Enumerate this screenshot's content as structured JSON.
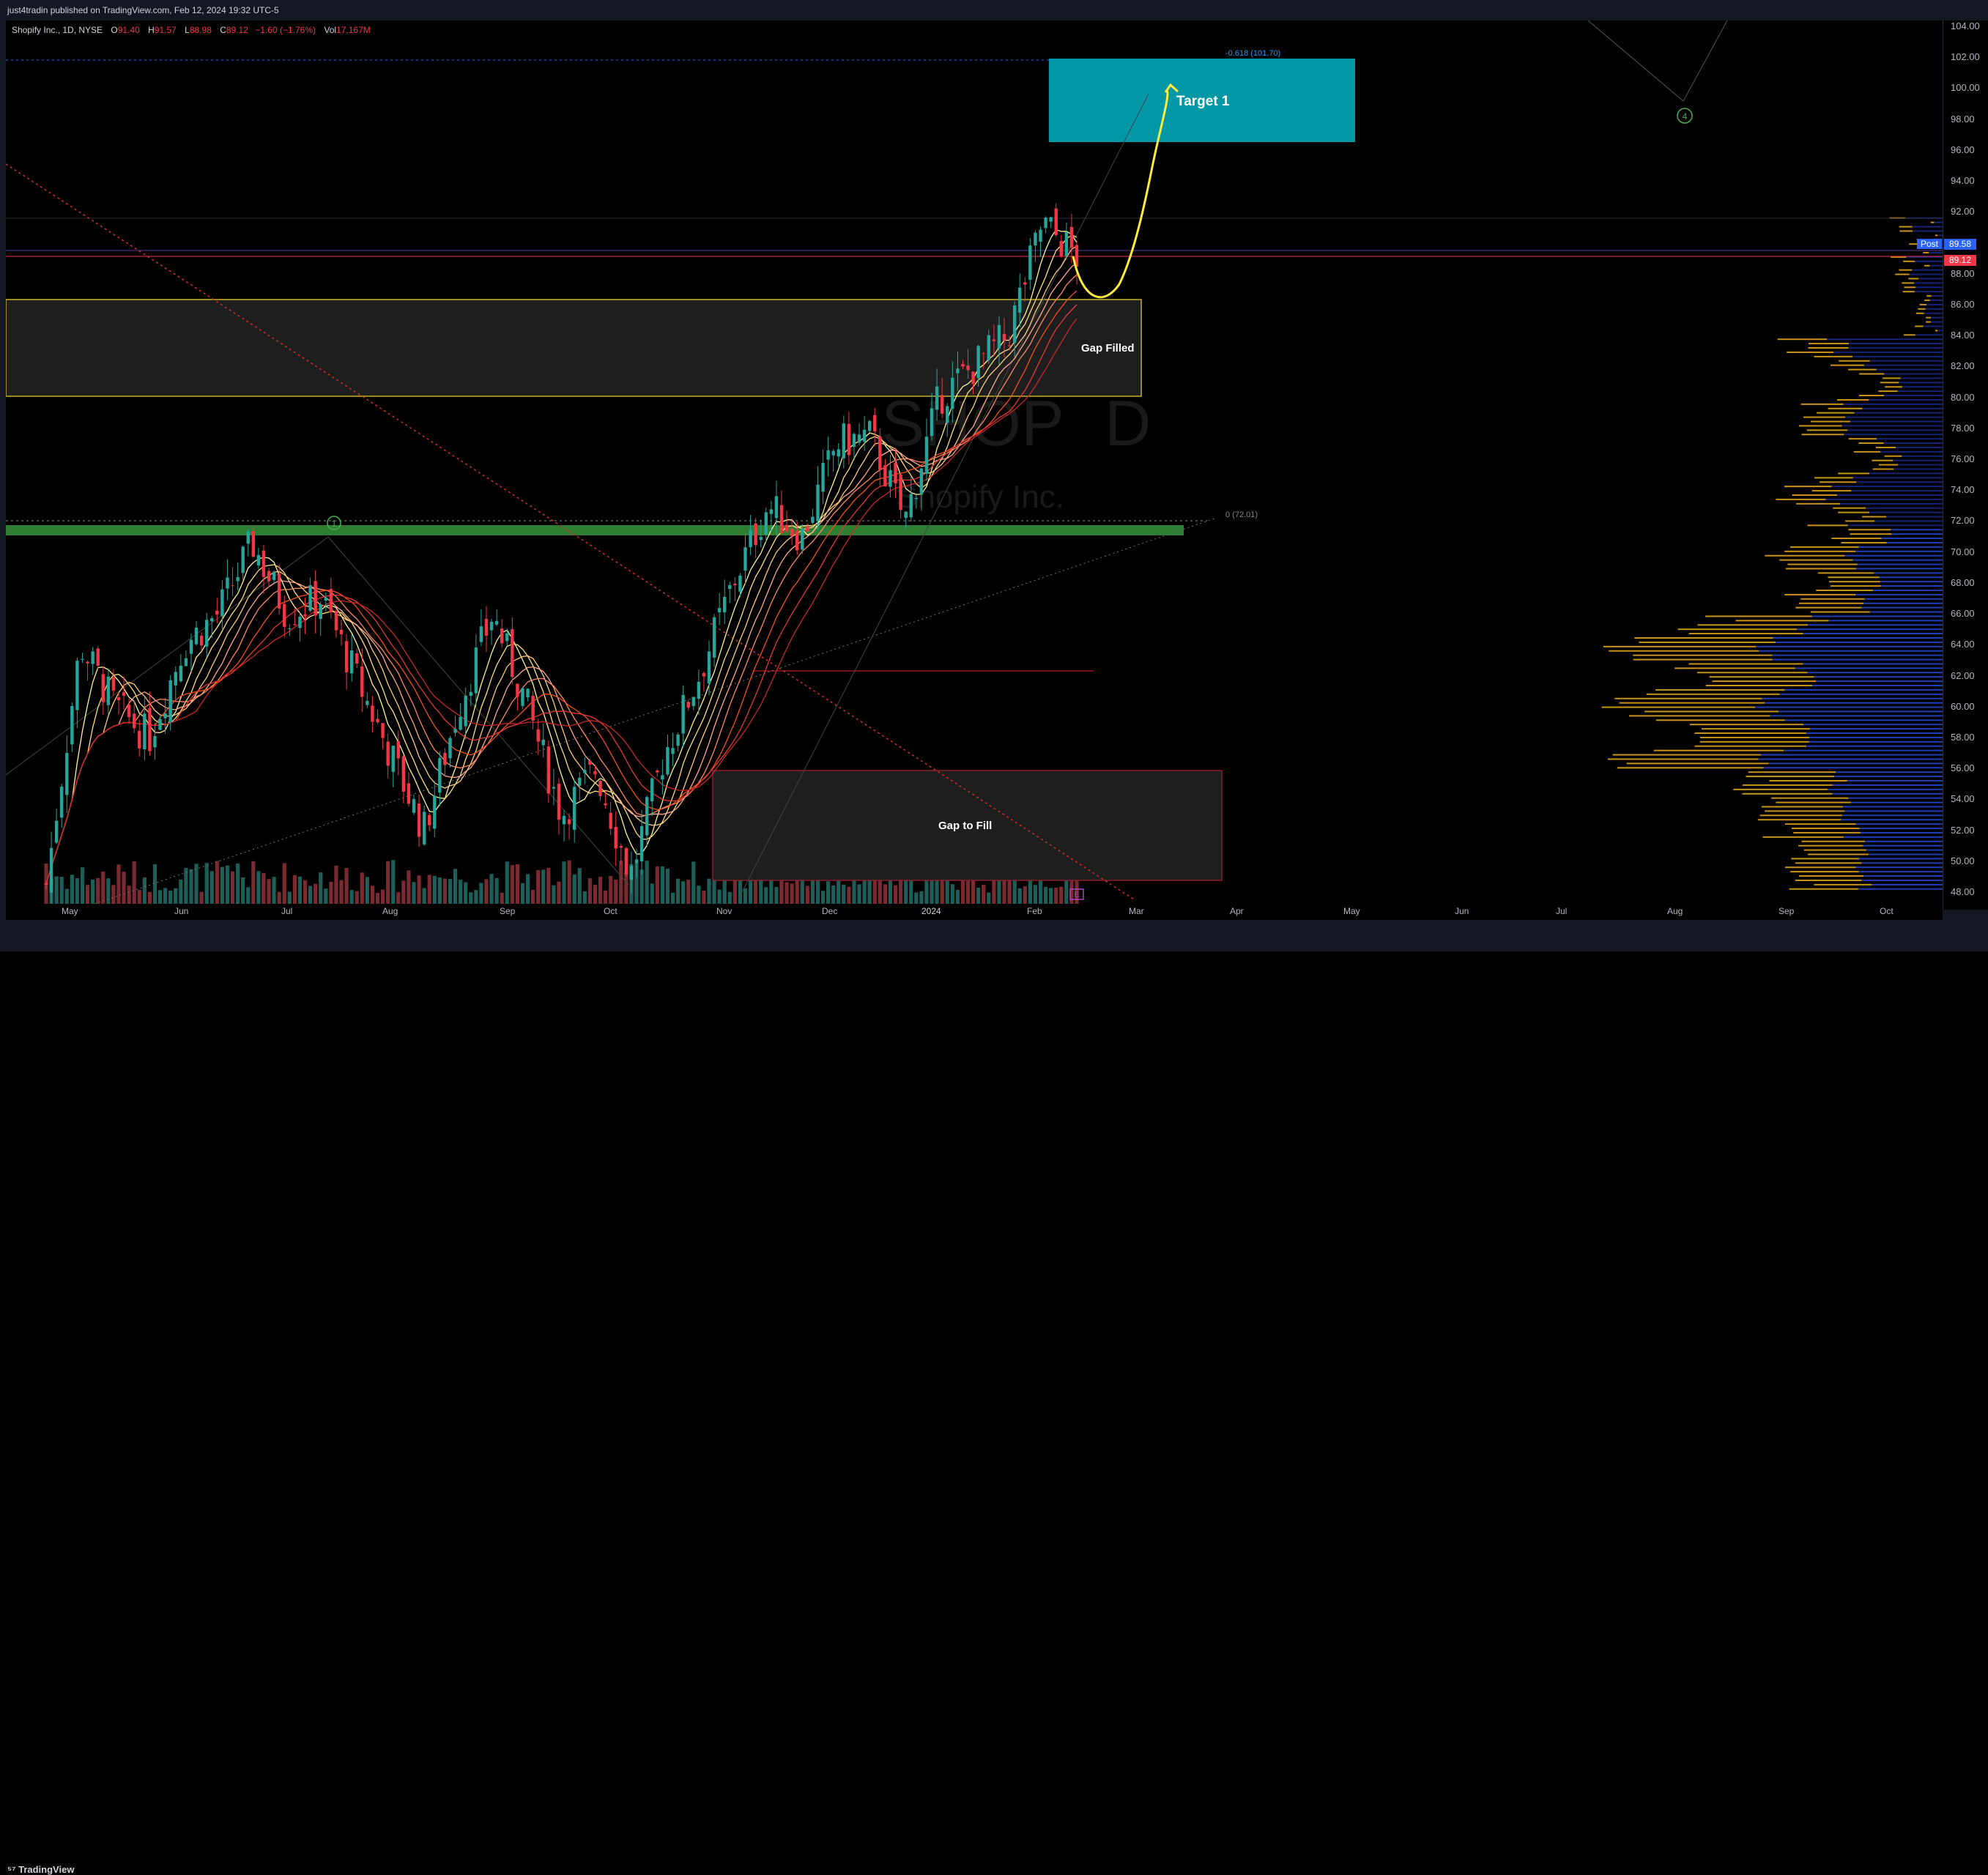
{
  "header": {
    "published": "just4tradin published on TradingView.com, Feb 12, 2024 19:32 UTC-5"
  },
  "legend": {
    "symbol": "Shopify Inc., 1D, NYSE",
    "o_label": "O",
    "o_val": "91.40",
    "h_label": "H",
    "h_val": "91.57",
    "l_label": "L",
    "l_val": "88.98",
    "c_label": "C",
    "c_val": "89.12",
    "change": "−1.60 (−1.76%)",
    "vol_label": "Vol",
    "vol_val": "17.167M"
  },
  "price_axis": {
    "labels": [
      "104.00",
      "102.00",
      "100.00",
      "98.00",
      "96.00",
      "94.00",
      "92.00",
      "88.00",
      "86.00",
      "84.00",
      "82.00",
      "80.00",
      "78.00",
      "76.00",
      "74.00",
      "72.00",
      "70.00",
      "68.00",
      "66.00",
      "64.00",
      "62.00",
      "60.00",
      "58.00",
      "56.00",
      "54.00",
      "52.00",
      "50.00",
      "48.00"
    ],
    "post_label": "Post",
    "post_value": "89.58",
    "close_value": "89.12"
  },
  "time_axis": {
    "labels": [
      "May",
      "Jun",
      "Jul",
      "Aug",
      "Sep",
      "Oct",
      "Nov",
      "Dec",
      "2024",
      "Feb",
      "Mar",
      "Apr",
      "May",
      "Jun",
      "Jul",
      "Aug",
      "Sep",
      "Oct"
    ]
  },
  "annotations": {
    "target": "Target 1",
    "gap_filled": "Gap Filled",
    "gap_to_fill": "Gap to Fill",
    "fib_top": "-0.618 (101.70)",
    "fib_zero": "0 (72.01)",
    "wave1": "1",
    "wave4": "4",
    "earnings": "E"
  },
  "watermark": {
    "ticker": "SHOP",
    "suffix": "D",
    "name": "Shopify Inc."
  },
  "footer": {
    "brand": "TradingView"
  },
  "colors": {
    "up": "#26a69a",
    "down": "#f23645",
    "target": "#0097a7",
    "green_zone": "#4caf50",
    "yellow": "#ffeb3b",
    "volume_up": "#1e5e58",
    "volume_down": "#7a2a31"
  },
  "chart_data": {
    "type": "candlestick",
    "symbol": "SHOP",
    "timeframe": "1D",
    "ylim": [
      47,
      105
    ],
    "x_range": [
      "May 2023",
      "Oct 2024"
    ],
    "price_path": [
      [
        "2023-05-01",
        48.5
      ],
      [
        "2023-05-10",
        64
      ],
      [
        "2023-05-20",
        60
      ],
      [
        "2023-06-01",
        58
      ],
      [
        "2023-06-15",
        64
      ],
      [
        "2023-07-01",
        66
      ],
      [
        "2023-07-15",
        70.6
      ],
      [
        "2023-07-25",
        66
      ],
      [
        "2023-08-01",
        67
      ],
      [
        "2023-08-10",
        62
      ],
      [
        "2023-08-20",
        57
      ],
      [
        "2023-09-01",
        52
      ],
      [
        "2023-09-10",
        60
      ],
      [
        "2023-09-20",
        66
      ],
      [
        "2023-10-01",
        60
      ],
      [
        "2023-10-10",
        53
      ],
      [
        "2023-10-20",
        56
      ],
      [
        "2023-11-01",
        49
      ],
      [
        "2023-11-08",
        57
      ],
      [
        "2023-11-15",
        62
      ],
      [
        "2023-11-25",
        68
      ],
      [
        "2023-12-01",
        73
      ],
      [
        "2023-12-10",
        71
      ],
      [
        "2023-12-20",
        77
      ],
      [
        "2024-01-01",
        77.5
      ],
      [
        "2024-01-10",
        72
      ],
      [
        "2024-01-20",
        80
      ],
      [
        "2024-01-30",
        82
      ],
      [
        "2024-02-07",
        84
      ],
      [
        "2024-02-09",
        91.3
      ],
      [
        "2024-02-12",
        89.12
      ]
    ],
    "levels": [
      {
        "label": "0 (72.01)",
        "value": 72.01
      },
      {
        "label": "-0.618 (101.70)",
        "value": 101.7
      }
    ],
    "zones": [
      {
        "label": "Target 1",
        "from": 96.5,
        "to": 102
      },
      {
        "label": "Gap Filled",
        "from": 80.1,
        "to": 86.3
      },
      {
        "label": "Gap to Fill",
        "from": 48.9,
        "to": 56
      }
    ],
    "last": {
      "post": 89.58,
      "close": 89.12
    }
  }
}
